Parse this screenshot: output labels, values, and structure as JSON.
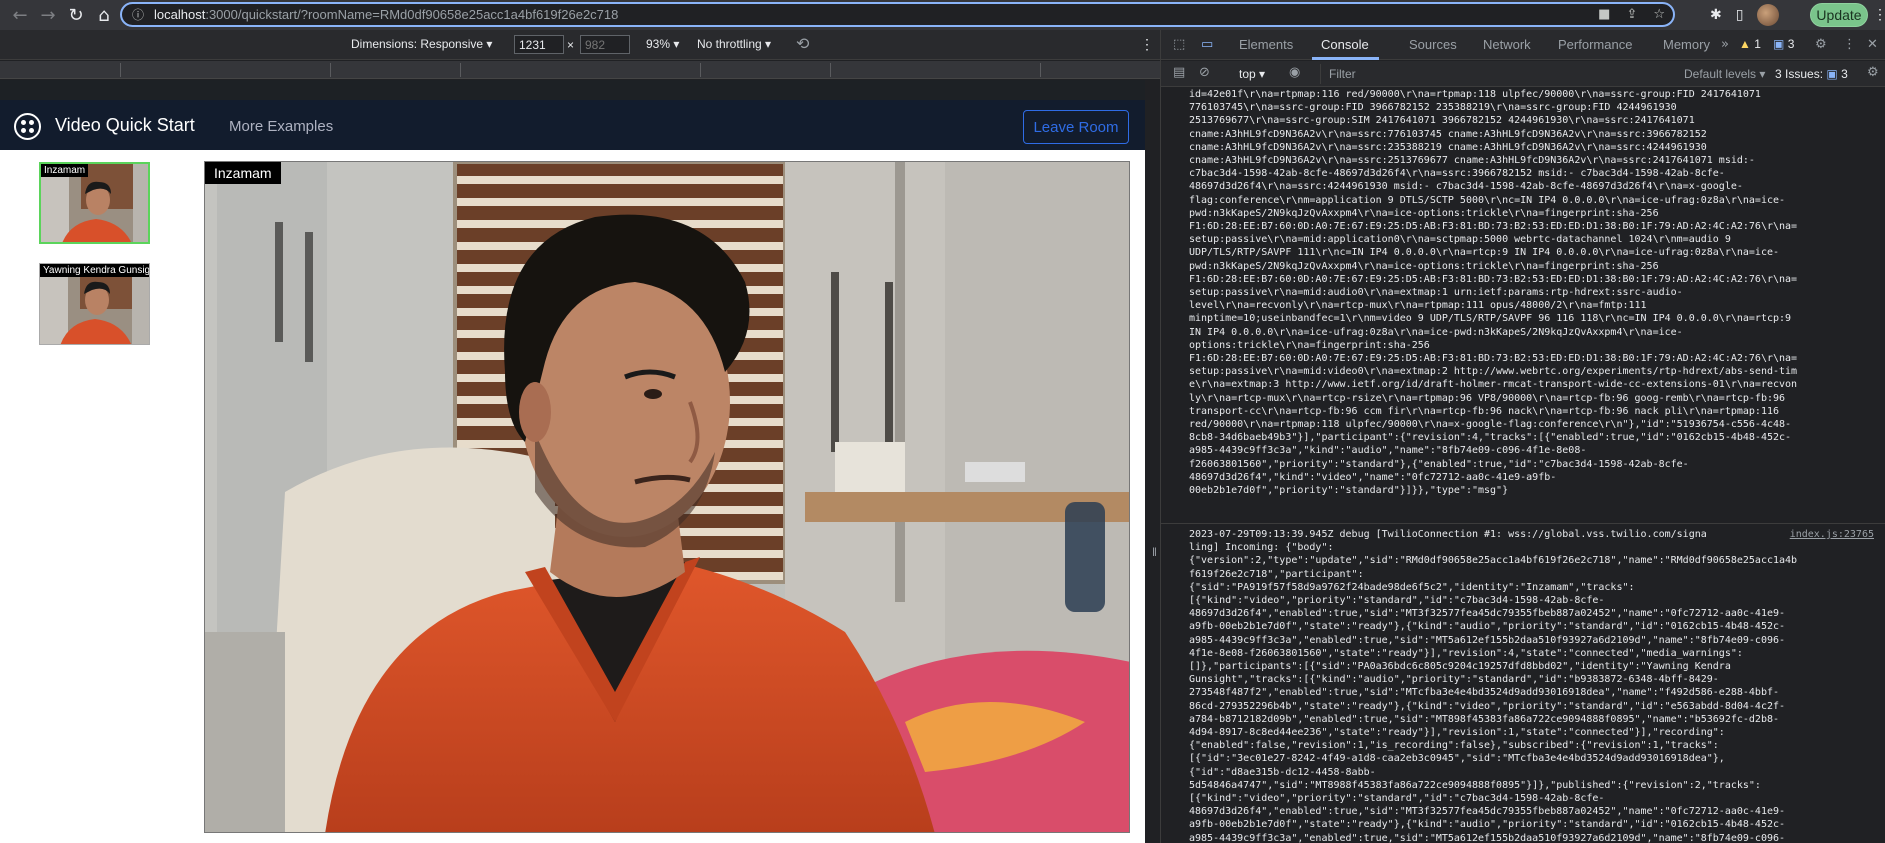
{
  "browser": {
    "url_host": "localhost",
    "url_path": ":3000/quickstart/?roomName=RMd0df90658e25acc1a4bf619f26e2c718",
    "update_label": "Update"
  },
  "device_toolbar": {
    "dimensions_label": "Dimensions: Responsive",
    "width_value": "1231",
    "height_placeholder": "982",
    "times": "×",
    "zoom_label": "93%",
    "throttling_label": "No throttling"
  },
  "app": {
    "title": "Video Quick Start",
    "more_examples": "More Examples",
    "leave_room": "Leave Room",
    "thumbnails": [
      {
        "label": "Inzamam"
      },
      {
        "label": "Yawning Kendra Gunsight"
      }
    ],
    "main_label": "Inzamam"
  },
  "devtools": {
    "tabs": [
      "Elements",
      "Console",
      "Sources",
      "Network",
      "Performance",
      "Memory"
    ],
    "warnings_count": "1",
    "messages_count": "3",
    "context": "top",
    "filter_placeholder": "Filter",
    "levels": "Default levels",
    "issues_label": "3 Issues:",
    "issues_count": "3",
    "source_link": "index.js:23765",
    "log_block_1": [
      "id=42e01f\\r\\na=rtpmap:116 red/90000\\r\\na=rtpmap:118 ulpfec/90000\\r\\na=ssrc-group:FID 2417641071",
      "776103745\\r\\na=ssrc-group:FID 3966782152 235388219\\r\\na=ssrc-group:FID 4244961930",
      "2513769677\\r\\na=ssrc-group:SIM 2417641071 3966782152 4244961930\\r\\na=ssrc:2417641071",
      "cname:A3hHL9fcD9N36A2v\\r\\na=ssrc:776103745 cname:A3hHL9fcD9N36A2v\\r\\na=ssrc:3966782152",
      "cname:A3hHL9fcD9N36A2v\\r\\na=ssrc:235388219 cname:A3hHL9fcD9N36A2v\\r\\na=ssrc:4244961930",
      "cname:A3hHL9fcD9N36A2v\\r\\na=ssrc:2513769677 cname:A3hHL9fcD9N36A2v\\r\\na=ssrc:2417641071 msid:-",
      "c7bac3d4-1598-42ab-8cfe-48697d3d26f4\\r\\na=ssrc:3966782152 msid:- c7bac3d4-1598-42ab-8cfe-",
      "48697d3d26f4\\r\\na=ssrc:4244961930 msid:- c7bac3d4-1598-42ab-8cfe-48697d3d26f4\\r\\na=x-google-",
      "flag:conference\\r\\nm=application 9 DTLS/SCTP 5000\\r\\nc=IN IP4 0.0.0.0\\r\\na=ice-ufrag:0z8a\\r\\na=ice-",
      "pwd:n3kKapeS/2N9kqJzQvAxxpm4\\r\\na=ice-options:trickle\\r\\na=fingerprint:sha-256",
      "F1:6D:28:EE:B7:60:0D:A0:7E:67:E9:25:D5:AB:F3:81:BD:73:B2:53:ED:ED:D1:38:B0:1F:79:AD:A2:4C:A2:76\\r\\na=",
      "setup:passive\\r\\na=mid:application0\\r\\na=sctpmap:5000 webrtc-datachannel 1024\\r\\nm=audio 9",
      "UDP/TLS/RTP/SAVPF 111\\r\\nc=IN IP4 0.0.0.0\\r\\na=rtcp:9 IN IP4 0.0.0.0\\r\\na=ice-ufrag:0z8a\\r\\na=ice-",
      "pwd:n3kKapeS/2N9kqJzQvAxxpm4\\r\\na=ice-options:trickle\\r\\na=fingerprint:sha-256",
      "F1:6D:28:EE:B7:60:0D:A0:7E:67:E9:25:D5:AB:F3:81:BD:73:B2:53:ED:ED:D1:38:B0:1F:79:AD:A2:4C:A2:76\\r\\na=",
      "setup:passive\\r\\na=mid:audio0\\r\\na=extmap:1 urn:ietf:params:rtp-hdrext:ssrc-audio-",
      "level\\r\\na=recvonly\\r\\na=rtcp-mux\\r\\na=rtpmap:111 opus/48000/2\\r\\na=fmtp:111",
      "minptime=10;useinbandfec=1\\r\\nm=video 9 UDP/TLS/RTP/SAVPF 96 116 118\\r\\nc=IN IP4 0.0.0.0\\r\\na=rtcp:9",
      "IN IP4 0.0.0.0\\r\\na=ice-ufrag:0z8a\\r\\na=ice-pwd:n3kKapeS/2N9kqJzQvAxxpm4\\r\\na=ice-",
      "options:trickle\\r\\na=fingerprint:sha-256",
      "F1:6D:28:EE:B7:60:0D:A0:7E:67:E9:25:D5:AB:F3:81:BD:73:B2:53:ED:ED:D1:38:B0:1F:79:AD:A2:4C:A2:76\\r\\na=",
      "setup:passive\\r\\na=mid:video0\\r\\na=extmap:2 http://www.webrtc.org/experiments/rtp-hdrext/abs-send-tim",
      "e\\r\\na=extmap:3 http://www.ietf.org/id/draft-holmer-rmcat-transport-wide-cc-extensions-01\\r\\na=recvon",
      "ly\\r\\na=rtcp-mux\\r\\na=rtcp-rsize\\r\\na=rtpmap:96 VP8/90000\\r\\na=rtcp-fb:96 goog-remb\\r\\na=rtcp-fb:96",
      "transport-cc\\r\\na=rtcp-fb:96 ccm fir\\r\\na=rtcp-fb:96 nack\\r\\na=rtcp-fb:96 nack pli\\r\\na=rtpmap:116",
      "red/90000\\r\\na=rtpmap:118 ulpfec/90000\\r\\na=x-google-flag:conference\\r\\n\"},\"id\":\"51936754-c556-4c48-",
      "8cb8-34d6baeb49b3\"}],\"participant\":{\"revision\":4,\"tracks\":[{\"enabled\":true,\"id\":\"0162cb15-4b48-452c-",
      "a985-4439c9ff3c3a\",\"kind\":\"audio\",\"name\":\"8fb74e09-c096-4f1e-8e08-",
      "f26063801560\",\"priority\":\"standard\"},{\"enabled\":true,\"id\":\"c7bac3d4-1598-42ab-8cfe-",
      "48697d3d26f4\",\"kind\":\"video\",\"name\":\"0fc72712-aa0c-41e9-a9fb-",
      "00eb2b1e7d0f\",\"priority\":\"standard\"}]}},\"type\":\"msg\"}"
    ],
    "log_block_2": [
      "2023-07-29T09:13:39.945Z debug [TwilioConnection #1: wss://global.vss.twilio.com/signa",
      "ling] Incoming: {\"body\":",
      "{\"version\":2,\"type\":\"update\",\"sid\":\"RMd0df90658e25acc1a4bf619f26e2c718\",\"name\":\"RMd0df90658e25acc1a4b",
      "f619f26e2c718\",\"participant\":",
      "{\"sid\":\"PA919f57f58d9a9762f24bade98de6f5c2\",\"identity\":\"Inzamam\",\"tracks\":",
      "[{\"kind\":\"video\",\"priority\":\"standard\",\"id\":\"c7bac3d4-1598-42ab-8cfe-",
      "48697d3d26f4\",\"enabled\":true,\"sid\":\"MT3f32577fea45dc79355fbeb887a02452\",\"name\":\"0fc72712-aa0c-41e9-",
      "a9fb-00eb2b1e7d0f\",\"state\":\"ready\"},{\"kind\":\"audio\",\"priority\":\"standard\",\"id\":\"0162cb15-4b48-452c-",
      "a985-4439c9ff3c3a\",\"enabled\":true,\"sid\":\"MT5a612ef155b2daa510f93927a6d2109d\",\"name\":\"8fb74e09-c096-",
      "4f1e-8e08-f26063801560\",\"state\":\"ready\"}],\"revision\":4,\"state\":\"connected\",\"media_warnings\":",
      "[]},\"participants\":[{\"sid\":\"PA0a36bdc6c805c9204c19257dfd8bbd02\",\"identity\":\"Yawning Kendra",
      "Gunsight\",\"tracks\":[{\"kind\":\"audio\",\"priority\":\"standard\",\"id\":\"b9383872-6348-4bff-8429-",
      "273548f487f2\",\"enabled\":true,\"sid\":\"MTcfba3e4e4bd3524d9add93016918dea\",\"name\":\"f492d586-e288-4bbf-",
      "86cd-279352296b4b\",\"state\":\"ready\"},{\"kind\":\"video\",\"priority\":\"standard\",\"id\":\"e563abdd-8d04-4c2f-",
      "a784-b8712182d09b\",\"enabled\":true,\"sid\":\"MT898f45383fa86a722ce9094888f0895\",\"name\":\"b53692fc-d2b8-",
      "4d94-8917-8c8ed44ee236\",\"state\":\"ready\"}],\"revision\":1,\"state\":\"connected\"}],\"recording\":",
      "{\"enabled\":false,\"revision\":1,\"is_recording\":false},\"subscribed\":{\"revision\":1,\"tracks\":",
      "[{\"id\":\"3ec01e27-8242-4f49-a1d8-caa2eb3c0945\",\"sid\":\"MTcfba3e4e4bd3524d9add93016918dea\"},",
      "{\"id\":\"d8ae315b-dc12-4458-8abb-",
      "5d54846a4747\",\"sid\":\"MT8988f45383fa86a722ce9094888f0895\"}]},\"published\":{\"revision\":2,\"tracks\":",
      "[{\"kind\":\"video\",\"priority\":\"standard\",\"id\":\"c7bac3d4-1598-42ab-8cfe-",
      "48697d3d26f4\",\"enabled\":true,\"sid\":\"MT3f32577fea45dc79355fbeb887a02452\",\"name\":\"0fc72712-aa0c-41e9-",
      "a9fb-00eb2b1e7d0f\",\"state\":\"ready\"},{\"kind\":\"audio\",\"priority\":\"standard\",\"id\":\"0162cb15-4b48-452c-",
      "a985-4439c9ff3c3a\",\"enabled\":true,\"sid\":\"MT5a612ef155b2daa510f93927a6d2109d\",\"name\":\"8fb74e09-c096-",
      "4f1e-8e08-f26063801560\",\"state\":\"ready\"}]}},\"type\":\"msg\"}"
    ]
  }
}
